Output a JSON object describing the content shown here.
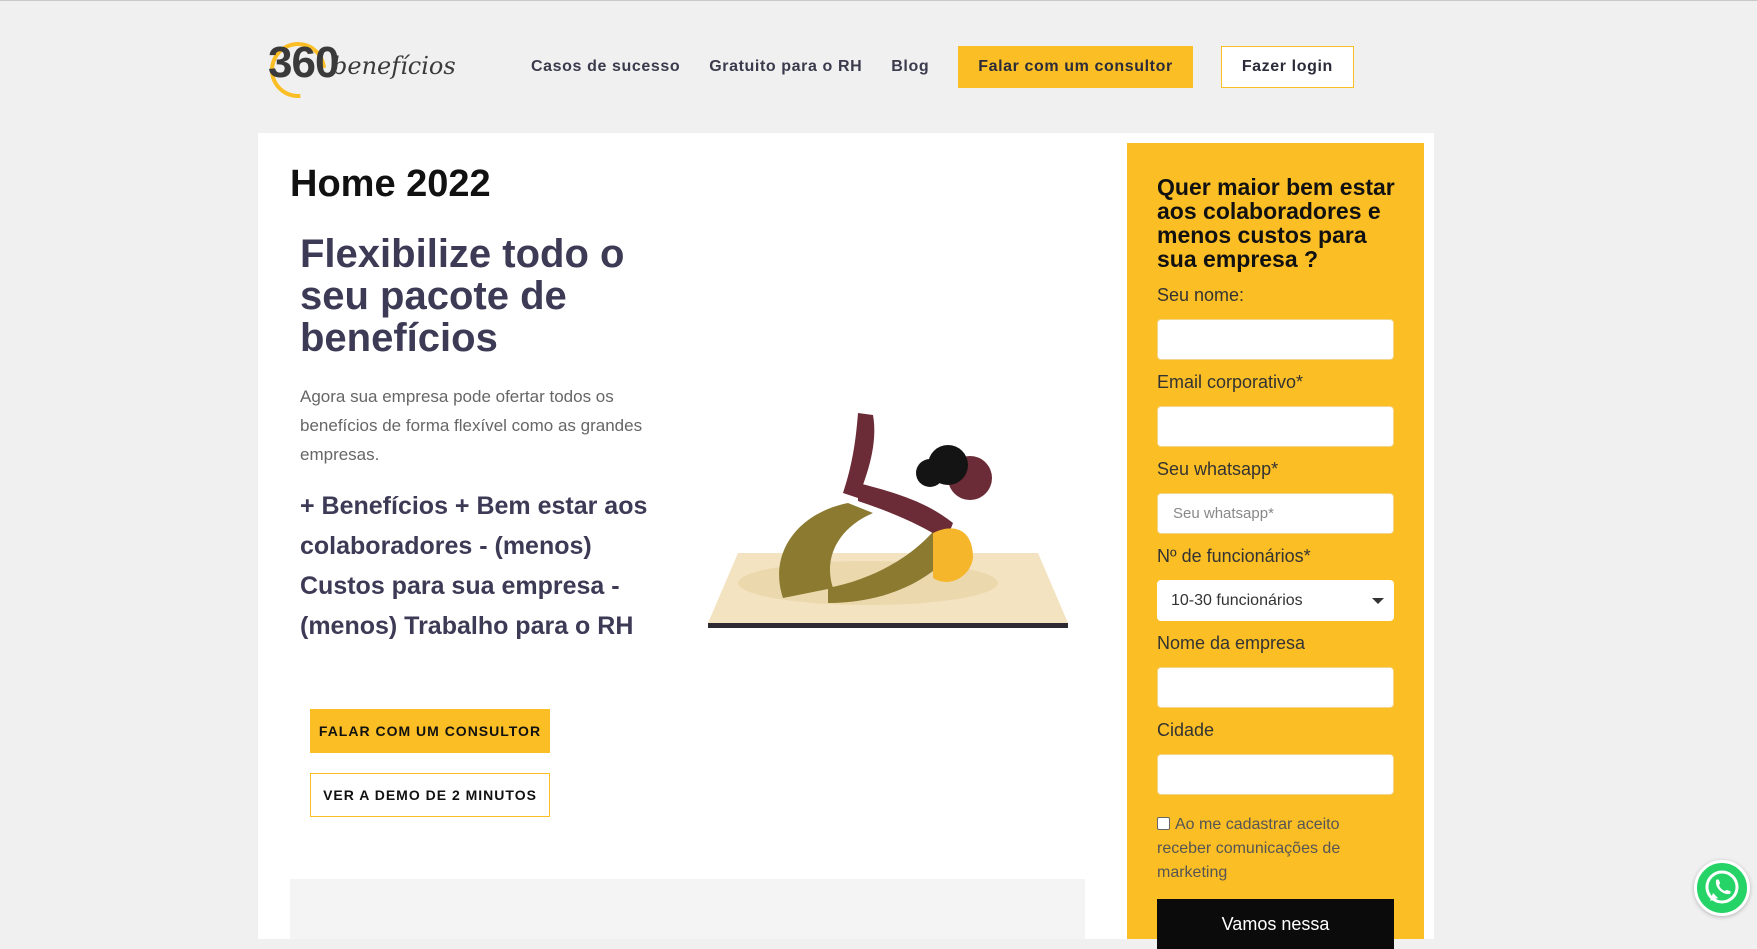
{
  "logo": {
    "number": "360",
    "word": "benefícios"
  },
  "nav": {
    "items": [
      "Casos de sucesso",
      "Gratuito para o RH",
      "Blog"
    ],
    "consultor_label": "Falar com um consultor",
    "login_label": "Fazer login"
  },
  "page": {
    "title": "Home 2022"
  },
  "hero": {
    "title": "Flexibilize todo o seu pacote de benefícios",
    "description": "Agora sua empresa pode ofertar todos os benefícios de forma flexível como as grandes empresas.",
    "highlight": "+ Benefícios + Bem estar aos colaboradores - (menos) Custos para sua empresa - (menos) Trabalho para o RH",
    "cta_label": "FALAR COM UM CONSULTOR",
    "demo_label": "VER A DEMO DE 2 MINUTOS"
  },
  "form": {
    "title": "Quer maior bem estar aos colaboradores e menos custos para sua empresa ?",
    "name_label": "Seu nome:",
    "email_label": "Email corporativo*",
    "whatsapp_label": "Seu whatsapp*",
    "whatsapp_placeholder": "Seu whatsapp*",
    "employees_label": "Nº de funcionários*",
    "employees_value": "10-30 funcionários",
    "company_label": "Nome da empresa",
    "city_label": "Cidade",
    "consent_text": "Ao me cadastrar aceito receber comunicações de marketing",
    "submit_label": "Vamos nessa"
  },
  "colors": {
    "accent": "#fbbe24",
    "heading": "#3d3a55",
    "background": "#f0f0f0",
    "whatsapp": "#25d366"
  },
  "icons": [
    "whatsapp-icon",
    "chevron-down-icon",
    "checkbox-icon"
  ]
}
